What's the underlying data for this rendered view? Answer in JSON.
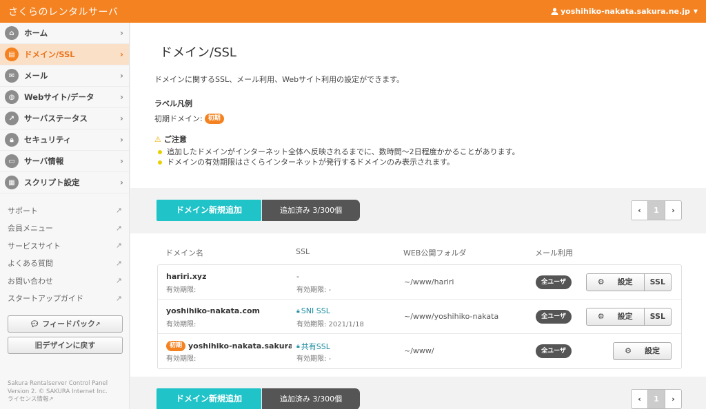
{
  "header": {
    "app_title": "さくらのレンタルサーバ",
    "user": "yoshihiko-nakata.sakura.ne.jp"
  },
  "sidebar": {
    "items": [
      {
        "label": "ホーム",
        "icon": "home-icon"
      },
      {
        "label": "ドメイン/SSL",
        "icon": "server-icon"
      },
      {
        "label": "メール",
        "icon": "mail-icon"
      },
      {
        "label": "Webサイト/データ",
        "icon": "globe-icon"
      },
      {
        "label": "サーバステータス",
        "icon": "chart-icon"
      },
      {
        "label": "セキュリティ",
        "icon": "lock-icon"
      },
      {
        "label": "サーバ情報",
        "icon": "info-icon"
      },
      {
        "label": "スクリプト設定",
        "icon": "script-icon"
      }
    ],
    "links": [
      "サポート",
      "会員メニュー",
      "サービスサイト",
      "よくある質問",
      "お問い合わせ",
      "スタートアップガイド"
    ],
    "feedback_label": "フィードバック",
    "old_design_label": "旧デザインに戻す",
    "footer_line1": "Sakura Rentalserver Control Panel",
    "footer_line2": "Version 2. © SAKURA Internet Inc.",
    "license_label": "ライセンス情報"
  },
  "intro": {
    "title": "ドメイン/SSL",
    "description": "ドメインに関するSSL、メール利用、Webサイト利用の設定ができます。",
    "legend_title": "ラベル凡例",
    "legend_label": "初期ドメイン:",
    "legend_badge": "初期",
    "notice_title": "ご注意",
    "notices": [
      "追加したドメインがインターネット全体へ反映されるまでに、数時間〜2日程度かかることがあります。",
      "ドメインの有効期限はさくらインターネットが発行するドメインのみ表示されます。"
    ]
  },
  "toolbar": {
    "add_label": "ドメイン新規追加",
    "count_label": "追加済み 3/300個",
    "page": "1"
  },
  "columns": {
    "domain": "ドメイン名",
    "ssl": "SSL",
    "folder": "WEB公開フォルダ",
    "mail": "メール利用"
  },
  "rows": [
    {
      "domain": "hariri.xyz",
      "domain_exp": "有効期限:",
      "ssl": "-",
      "ssl_exp": "有効期限: -",
      "folder": "~/www/hariri",
      "mail": "全ユーザ",
      "settings": "設定",
      "ssl_btn": "SSL"
    },
    {
      "domain": "yoshihiko-nakata.com",
      "domain_exp": "有効期限:",
      "ssl": "SNI SSL",
      "ssl_exp": "有効期限: 2021/1/18",
      "folder": "~/www/yoshihiko-nakata",
      "mail": "全ユーザ",
      "settings": "設定",
      "ssl_btn": "SSL"
    },
    {
      "domain": "yoshihiko-nakata.sakura.…",
      "badge": "初期",
      "domain_exp": "有効期限:",
      "ssl": "共有SSL",
      "ssl_exp": "有効期限: -",
      "folder": "~/www/",
      "mail": "全ユーザ",
      "settings": "設定"
    }
  ],
  "colors": {
    "brand": "#f58220",
    "accent": "#1fc3c8",
    "dark": "#555555"
  }
}
